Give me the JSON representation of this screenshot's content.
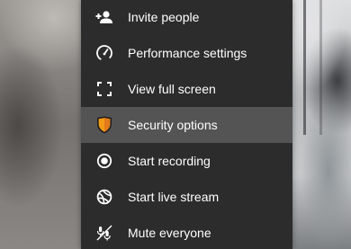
{
  "menu": {
    "items": [
      {
        "label": "Invite people",
        "icon": "invite-people-icon",
        "selected": false
      },
      {
        "label": "Performance settings",
        "icon": "speedometer-icon",
        "selected": false
      },
      {
        "label": "View full screen",
        "icon": "fullscreen-icon",
        "selected": false
      },
      {
        "label": "Security options",
        "icon": "security-shield-icon",
        "selected": true
      },
      {
        "label": "Start recording",
        "icon": "record-icon",
        "selected": false
      },
      {
        "label": "Start live stream",
        "icon": "live-stream-icon",
        "selected": false
      },
      {
        "label": "Mute everyone",
        "icon": "mute-everyone-icon",
        "selected": false
      }
    ]
  },
  "colors": {
    "menu_background": "#2c2c2c",
    "selected_background": "#545454",
    "text": "#ffffff",
    "shield_orange": "#f39b16"
  }
}
